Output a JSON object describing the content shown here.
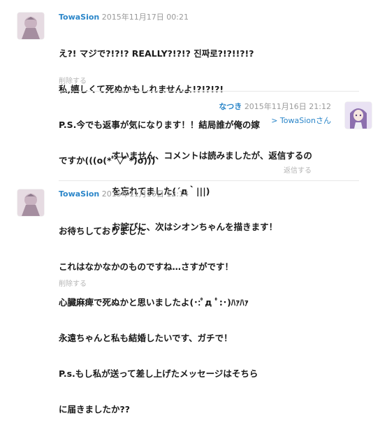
{
  "comments": [
    {
      "author": "TowaSion",
      "date": "2015年11月17日 00:21",
      "lines": [
        "え?! マジで?!?!? REALLY?!?!? 진짜로?!?!!?!?",
        "私,嬉しくて死ぬかもしれませんよ!?!?!?!",
        "P.S.今でも返事が気になります！！結局誰が俺の嫁",
        "ですか(((o(*ﾟ▽ﾟ*)o)))"
      ],
      "action": "削除する"
    },
    {
      "author": "なつき",
      "date": "2015年11月16日 21:12",
      "reply_to": "> TowaSionさん",
      "lines": [
        "すいません、コメントは読みましたが、返信するの",
        "を忘れてました(´д｀|||)",
        "お詫びに、次はシオンちゃんを描きます！"
      ],
      "action": "返信する"
    },
    {
      "author": "TowaSion",
      "date": "2015年11月16日 12:14",
      "lines": [
        "お待ちしておりました",
        "これはなかなかのものですね…さすがです！",
        "心臓麻痺で死ぬかと思いましたよ(･:ﾟд ﾟ:･)ﾊｧﾊｧ",
        "永遠ちゃんと私も結婚したいです、ガチで！",
        "P.s.もし私が送って差し上げたメッセージはそちら",
        "に届きましたか??"
      ],
      "action": "削除する"
    }
  ],
  "colors": {
    "author": "#2b86c9",
    "date": "#9a9a9a",
    "action": "#b5b5b5"
  }
}
